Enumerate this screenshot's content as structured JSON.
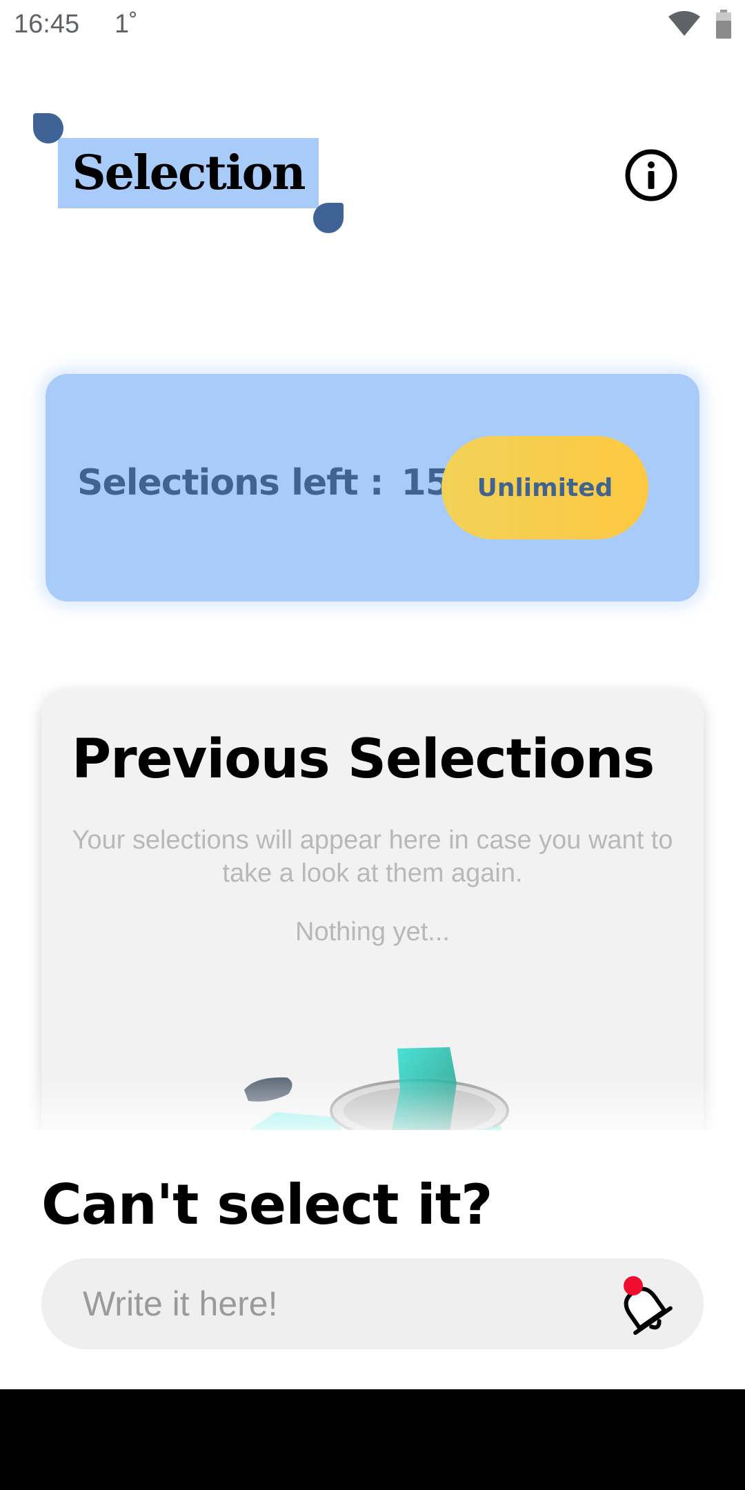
{
  "status_bar": {
    "time": "16:45",
    "temperature": "1˚",
    "wifi_icon": "wifi-icon",
    "battery_icon": "battery-icon"
  },
  "header": {
    "title": "Selection",
    "info_icon": "info-icon"
  },
  "selections_card": {
    "label": "Selections left :",
    "count": "15",
    "unlimited_label": "Unlimited"
  },
  "previous_selections": {
    "title": "Previous Selections",
    "description": "Your selections will appear here in case you want to take a look at them again.",
    "empty_text": "Nothing yet..."
  },
  "cant_select": {
    "title": "Can't select it?",
    "input_placeholder": "Write it here!",
    "submit_icon": "bell-icon"
  },
  "colors": {
    "highlight_blue": "#a9cbfa",
    "accent_navy": "#40648f",
    "drop_blue": "#3f6394",
    "unlimited_yellow": "#fec841",
    "notification_red": "#ef0d2f"
  }
}
